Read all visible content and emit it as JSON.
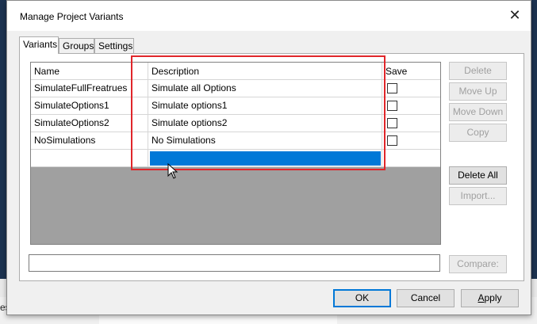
{
  "dialog": {
    "title": "Manage Project Variants",
    "close_symbol": "✕"
  },
  "tabs": [
    {
      "label": "Variants",
      "active": true
    },
    {
      "label": "Groups",
      "active": false
    },
    {
      "label": "Settings",
      "active": false
    }
  ],
  "grid": {
    "columns": [
      "Name",
      "Description",
      "Save"
    ],
    "rows": [
      {
        "name": "SimulateFullFreatrues",
        "description": "Simulate all Options"
      },
      {
        "name": "SimulateOptions1",
        "description": "Simulate options1"
      },
      {
        "name": "SimulateOptions2",
        "description": "Simulate options2"
      },
      {
        "name": "NoSimulations",
        "description": "No Simulations"
      }
    ]
  },
  "side_buttons": {
    "delete": "Delete",
    "move_up": "Move Up",
    "move_down": "Move Down",
    "copy": "Copy",
    "delete_all": "Delete All",
    "import": "Import...",
    "compare": "Compare:"
  },
  "footer": {
    "ok": "OK",
    "cancel": "Cancel",
    "apply": "Apply"
  },
  "background": {
    "bottom_text": "ess"
  },
  "colors": {
    "selection": "#0078d7",
    "highlight_box": "#e0262a"
  }
}
